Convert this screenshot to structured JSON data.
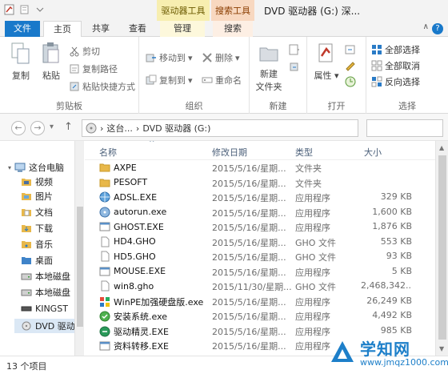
{
  "window": {
    "title": "DVD 驱动器 (G:) 深...",
    "context_groups": {
      "drive_tools": "驱动器工具",
      "search_tools": "搜索工具"
    }
  },
  "tabs": [
    {
      "label": "文件"
    },
    {
      "label": "主页"
    },
    {
      "label": "共享"
    },
    {
      "label": "查看"
    },
    {
      "label": "管理"
    },
    {
      "label": "搜索"
    }
  ],
  "help_label": "?",
  "ribbon": {
    "clipboard": {
      "label": "剪贴板",
      "copy": "复制",
      "paste": "粘贴",
      "cut": "剪切",
      "copy_path": "复制路径",
      "paste_shortcut": "粘贴快捷方式"
    },
    "organize": {
      "label": "组织",
      "move_to": "移动到",
      "copy_to": "复制到",
      "delete": "删除",
      "rename": "重命名"
    },
    "new": {
      "label": "新建",
      "new_folder_line1": "新建",
      "new_folder_line2": "文件夹"
    },
    "open": {
      "label": "打开",
      "properties": "属性"
    },
    "select": {
      "label": "选择",
      "select_all": "全部选择",
      "select_none": "全部取消",
      "invert": "反向选择"
    }
  },
  "address": {
    "path1": "这台...",
    "path2": "DVD 驱动器 (G:)",
    "sep": "›"
  },
  "nav_arrows": {
    "back": "←",
    "forward": "→",
    "dropdown": "▾",
    "up": "↑"
  },
  "nav": [
    {
      "label": "这台电脑"
    },
    {
      "label": "视频"
    },
    {
      "label": "图片"
    },
    {
      "label": "文档"
    },
    {
      "label": "下载"
    },
    {
      "label": "音乐"
    },
    {
      "label": "桌面"
    },
    {
      "label": "本地磁盘"
    },
    {
      "label": "本地磁盘"
    },
    {
      "label": "KINGST"
    },
    {
      "label": "DVD 驱动"
    }
  ],
  "columns": {
    "name": "名称",
    "date": "修改日期",
    "type": "类型",
    "size": "大小"
  },
  "files": [
    {
      "name": "AXPE",
      "date": "2015/5/16/星期...",
      "type": "文件夹",
      "size": "",
      "icon": "folder"
    },
    {
      "name": "PESOFT",
      "date": "2015/5/16/星期...",
      "type": "文件夹",
      "size": "",
      "icon": "folder"
    },
    {
      "name": "ADSL.EXE",
      "date": "2015/5/16/星期...",
      "type": "应用程序",
      "size": "329 KB",
      "icon": "globe"
    },
    {
      "name": "autorun.exe",
      "date": "2015/5/16/星期...",
      "type": "应用程序",
      "size": "1,600 KB",
      "icon": "disc"
    },
    {
      "name": "GHOST.EXE",
      "date": "2015/5/16/星期...",
      "type": "应用程序",
      "size": "1,876 KB",
      "icon": "app"
    },
    {
      "name": "HD4.GHO",
      "date": "2015/5/16/星期...",
      "type": "GHO 文件",
      "size": "553 KB",
      "icon": "doc"
    },
    {
      "name": "HD5.GHO",
      "date": "2015/5/16/星期...",
      "type": "GHO 文件",
      "size": "93 KB",
      "icon": "doc"
    },
    {
      "name": "MOUSE.EXE",
      "date": "2015/5/16/星期...",
      "type": "应用程序",
      "size": "5 KB",
      "icon": "app"
    },
    {
      "name": "win8.gho",
      "date": "2015/11/30/星期...",
      "type": "GHO 文件",
      "size": "2,468,342...",
      "icon": "doc"
    },
    {
      "name": "WinPE加强硬盘版.exe",
      "date": "2015/5/16/星期...",
      "type": "应用程序",
      "size": "26,249 KB",
      "icon": "winpe"
    },
    {
      "name": "安装系统.exe",
      "date": "2015/5/16/星期...",
      "type": "应用程序",
      "size": "4,492 KB",
      "icon": "install"
    },
    {
      "name": "驱动精灵.EXE",
      "date": "2015/5/16/星期...",
      "type": "应用程序",
      "size": "985 KB",
      "icon": "driver"
    },
    {
      "name": "资料转移.EXE",
      "date": "2015/5/16/星期...",
      "type": "应用程序",
      "size": "",
      "icon": "app"
    }
  ],
  "status": {
    "count": "13 个项目"
  },
  "watermark": {
    "title": "学知网",
    "url": "www.jmqz1000.com"
  },
  "colors": {
    "accent": "#1979ca",
    "folder": "#e8b84a",
    "drive_tab": "#f7eeb0",
    "search_tab": "#f8d8c0"
  }
}
